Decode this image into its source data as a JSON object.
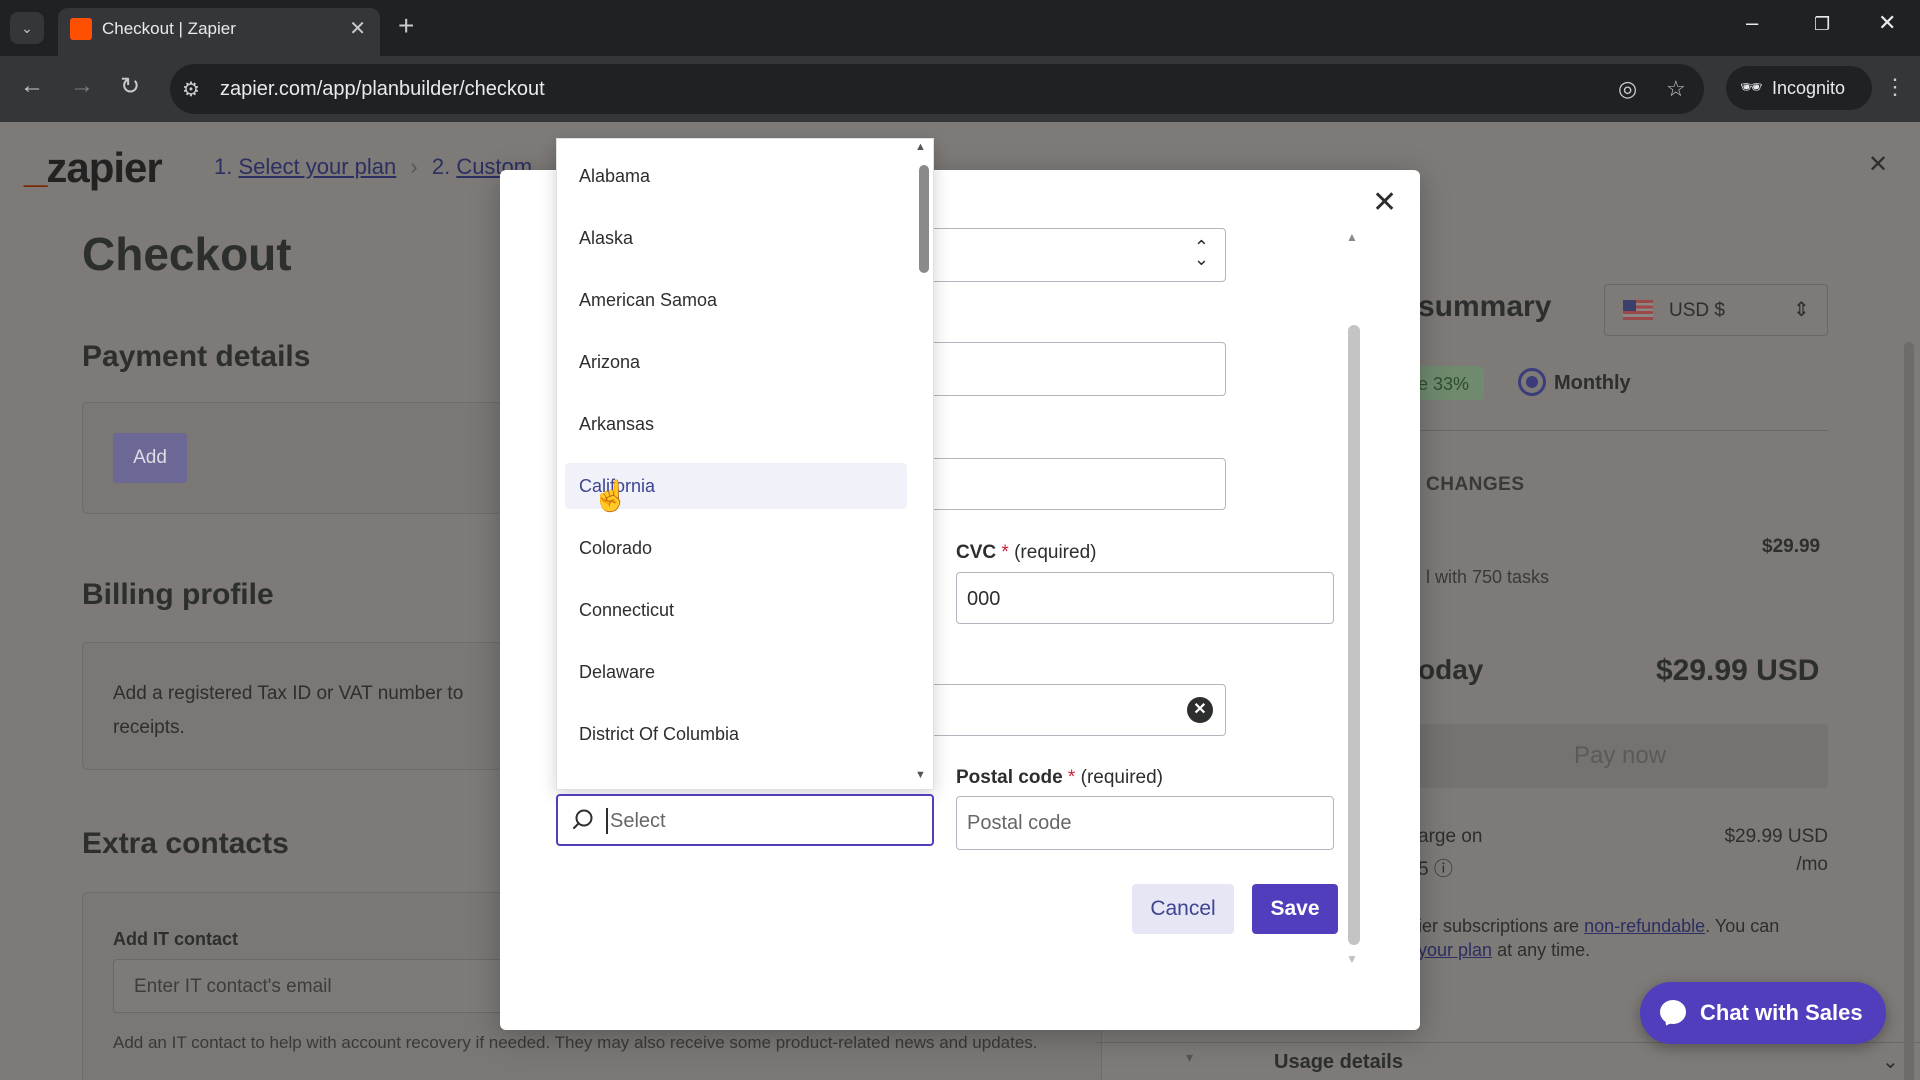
{
  "browser": {
    "tab_title": "Checkout | Zapier",
    "url": "zapier.com/app/planbuilder/checkout",
    "incognito_label": "Incognito"
  },
  "header": {
    "logo": "zapier",
    "steps": [
      {
        "number": "1.",
        "label": "Select your plan"
      },
      {
        "number": "2.",
        "label": "Custom"
      }
    ]
  },
  "main": {
    "title": "Checkout",
    "payment": {
      "title": "Payment details",
      "add_label": "Add"
    },
    "billing": {
      "title": "Billing profile",
      "text": "Add a registered Tax ID or VAT number to receipts."
    },
    "contacts": {
      "title": "Extra contacts",
      "it_label": "Add IT contact",
      "it_placeholder": "Enter IT contact's email",
      "help": "Add an IT contact to help with account recovery if needed. They may also receive some product-related news and updates."
    }
  },
  "summary": {
    "title": "summary",
    "currency": "USD $",
    "save_badge": "e 33%",
    "billing_cycle": "Monthly",
    "changes_label": "CHANGES",
    "line_price": "$29.99",
    "line_detail": "l with 750 tasks",
    "today_label": "oday",
    "today_amount": "$29.99 USD",
    "pay_label": "Pay now",
    "charge_label": "arge on",
    "charge_info": "5",
    "charge_amount": "$29.99 USD",
    "charge_per": "/mo",
    "refund_pre": "ier subscriptions are ",
    "refund_link": "non-refundable",
    "refund_mid": ". You can",
    "refund_link2": "your plan",
    "refund_post": " at any time.",
    "usage_label": "Usage details"
  },
  "modal": {
    "cvc": {
      "label": "CVC",
      "required": "(required)",
      "value": "000"
    },
    "postal": {
      "label": "Postal code",
      "required": "(required)",
      "placeholder": "Postal code"
    },
    "cancel_label": "Cancel",
    "save_label": "Save"
  },
  "dropdown": {
    "items": [
      "Alabama",
      "Alaska",
      "American Samoa",
      "Arizona",
      "Arkansas",
      "California",
      "Colorado",
      "Connecticut",
      "Delaware",
      "District Of Columbia"
    ],
    "highlighted": "California",
    "search_placeholder": "Select"
  },
  "chat": {
    "label": "Chat with Sales"
  },
  "colors": {
    "accent": "#503ebd",
    "brand": "#ff4f00"
  }
}
